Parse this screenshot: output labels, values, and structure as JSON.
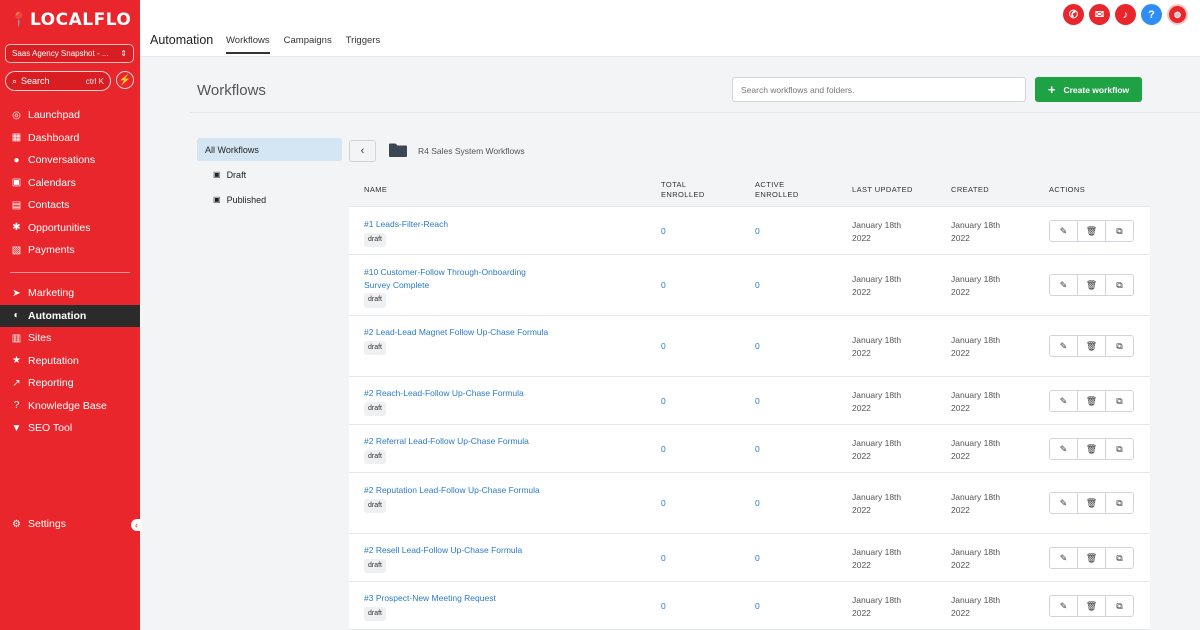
{
  "sidebar": {
    "logo": "LOCALFLO",
    "account": "Saas Agency Snapshot - ...",
    "search_label": "Search",
    "search_shortcut": "ctrl K",
    "items_top": [
      {
        "label": "Launchpad",
        "icon": "launchpad-icon"
      },
      {
        "label": "Dashboard",
        "icon": "dashboard-icon"
      },
      {
        "label": "Conversations",
        "icon": "chat-icon"
      },
      {
        "label": "Calendars",
        "icon": "calendar-icon"
      },
      {
        "label": "Contacts",
        "icon": "contacts-icon"
      },
      {
        "label": "Opportunities",
        "icon": "opportunities-icon"
      },
      {
        "label": "Payments",
        "icon": "payments-icon"
      }
    ],
    "items_bottom": [
      {
        "label": "Marketing",
        "icon": "send-icon"
      },
      {
        "label": "Automation",
        "icon": "automation-icon"
      },
      {
        "label": "Sites",
        "icon": "sites-icon"
      },
      {
        "label": "Reputation",
        "icon": "star-icon"
      },
      {
        "label": "Reporting",
        "icon": "chart-icon"
      },
      {
        "label": "Knowledge Base",
        "icon": "help-icon"
      },
      {
        "label": "SEO Tool",
        "icon": "funnel-icon"
      }
    ],
    "settings_label": "Settings"
  },
  "header": {
    "title": "Automation",
    "tabs": [
      "Workflows",
      "Campaigns",
      "Triggers"
    ],
    "active_tab": "Workflows"
  },
  "main": {
    "page_title": "Workflows",
    "search_placeholder": "Search workflows and folders.",
    "create_label": "Create workflow",
    "folders": [
      "All Workflows",
      "Draft",
      "Published"
    ],
    "breadcrumb": "R4 Sales System Workflows"
  },
  "table": {
    "headers": {
      "name": "NAME",
      "total": [
        "TOTAL",
        "ENROLLED"
      ],
      "active": [
        "ACTIVE",
        "ENROLLED"
      ],
      "updated": "LAST UPDATED",
      "created": "CREATED",
      "actions": "ACTIONS"
    },
    "rows": [
      {
        "name": "#1 Leads-Filter-Reach",
        "status": "draft",
        "total": "0",
        "active": "0",
        "updated": [
          "January 18th",
          "2022"
        ],
        "created": [
          "January 18th",
          "2022"
        ]
      },
      {
        "name": "#10 Customer-Follow Through-Onboarding Survey Complete",
        "status": "draft",
        "total": "0",
        "active": "0",
        "updated": [
          "January 18th",
          "2022"
        ],
        "created": [
          "January 18th",
          "2022"
        ]
      },
      {
        "name": "#2 Lead-Lead Magnet Follow Up-Chase Formula",
        "status": "draft",
        "total": "0",
        "active": "0",
        "updated": [
          "January 18th",
          "2022"
        ],
        "created": [
          "January 18th",
          "2022"
        ]
      },
      {
        "name": "#2 Reach-Lead-Follow Up-Chase Formula",
        "status": "draft",
        "total": "0",
        "active": "0",
        "updated": [
          "January 18th",
          "2022"
        ],
        "created": [
          "January 18th",
          "2022"
        ]
      },
      {
        "name": "#2 Referral Lead-Follow Up-Chase Formula",
        "status": "draft",
        "total": "0",
        "active": "0",
        "updated": [
          "January 18th",
          "2022"
        ],
        "created": [
          "January 18th",
          "2022"
        ]
      },
      {
        "name": "#2 Reputation Lead-Follow Up-Chase Formula",
        "status": "draft",
        "total": "0",
        "active": "0",
        "updated": [
          "January 18th",
          "2022"
        ],
        "created": [
          "January 18th",
          "2022"
        ]
      },
      {
        "name": "#2 Resell Lead-Follow Up-Chase Formula",
        "status": "draft",
        "total": "0",
        "active": "0",
        "updated": [
          "January 18th",
          "2022"
        ],
        "created": [
          "January 18th",
          "2022"
        ]
      },
      {
        "name": "#3 Prospect-New Meeting Request",
        "status": "draft",
        "total": "0",
        "active": "0",
        "updated": [
          "January 18th",
          "2022"
        ],
        "created": [
          "January 18th",
          "2022"
        ]
      }
    ]
  },
  "colors": {
    "brand": "#e8262b",
    "accent_green": "#1fa244",
    "link": "#2b7bc6"
  }
}
